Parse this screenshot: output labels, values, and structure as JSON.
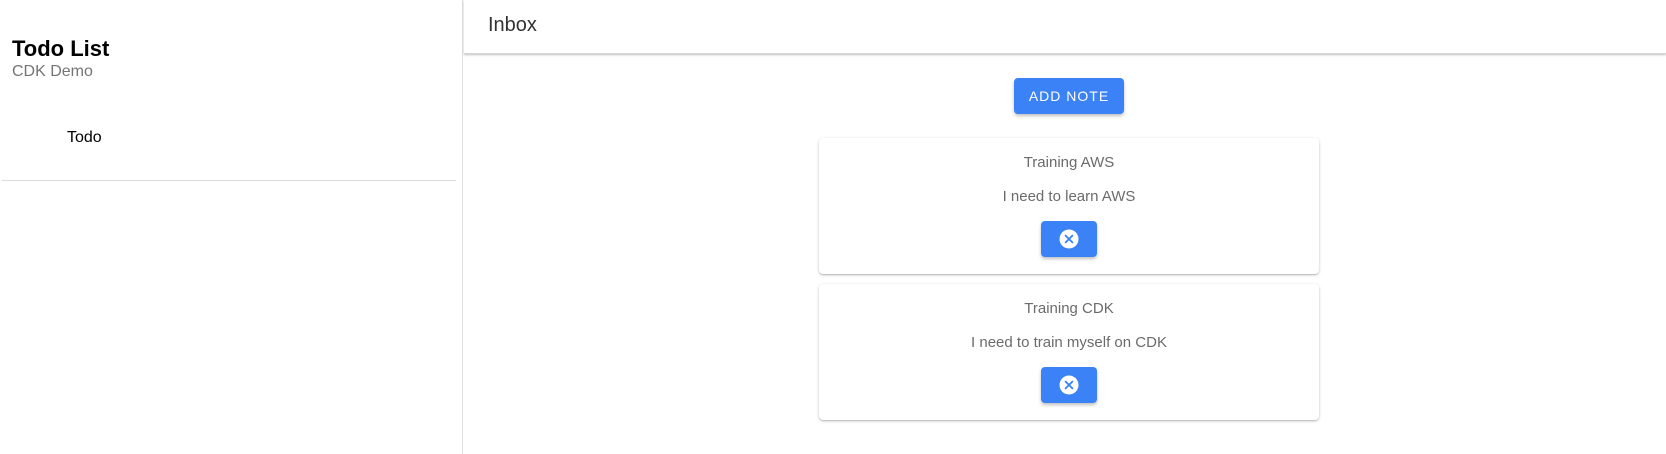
{
  "sidebar": {
    "title": "Todo List",
    "subtitle": "CDK Demo",
    "items": [
      {
        "label": "Todo"
      }
    ]
  },
  "header": {
    "title": "Inbox"
  },
  "main": {
    "add_button_label": "ADD NOTE",
    "notes": [
      {
        "title": "Training AWS",
        "description": "I need to learn AWS",
        "delete_icon": "close-circle-icon"
      },
      {
        "title": "Training CDK",
        "description": "I need to train myself on CDK",
        "delete_icon": "close-circle-icon"
      }
    ]
  },
  "colors": {
    "accent": "#3b82f6",
    "text_muted": "#6b6b6b"
  }
}
